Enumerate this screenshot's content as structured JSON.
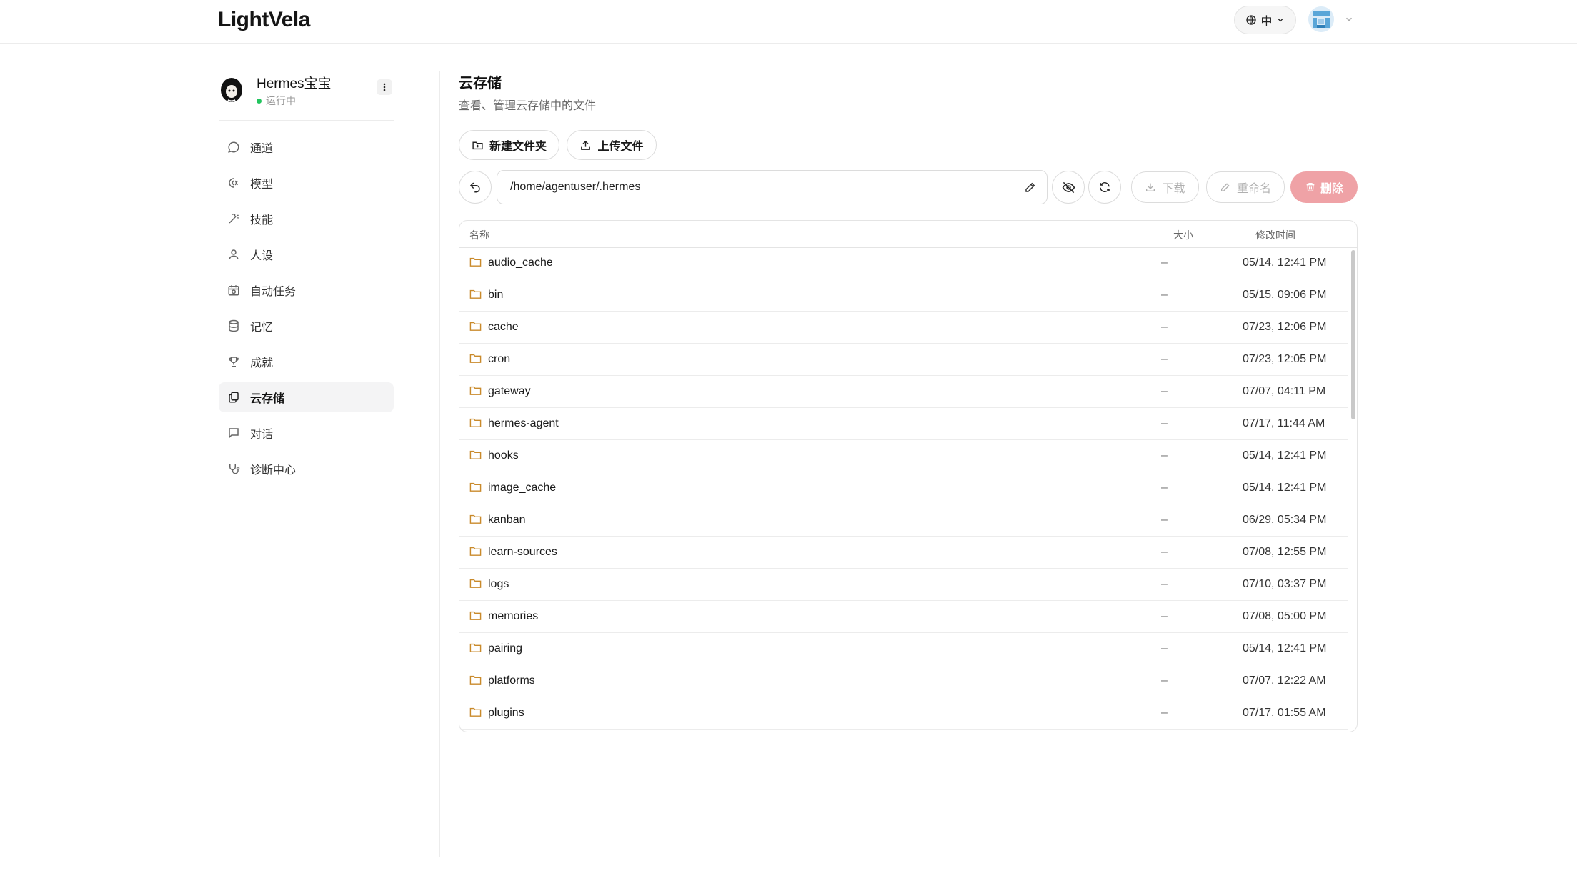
{
  "app": {
    "logo": "LightVela"
  },
  "header": {
    "lang_label": "中"
  },
  "agent": {
    "name": "Hermes宝宝",
    "status": "运行中"
  },
  "nav": [
    {
      "label": "通道",
      "icon": "chat-bubble-icon",
      "active": false
    },
    {
      "label": "模型",
      "icon": "model-icon",
      "active": false
    },
    {
      "label": "技能",
      "icon": "magic-wand-icon",
      "active": false
    },
    {
      "label": "人设",
      "icon": "user-icon",
      "active": false
    },
    {
      "label": "自动任务",
      "icon": "calendar-clock-icon",
      "active": false
    },
    {
      "label": "记忆",
      "icon": "database-icon",
      "active": false
    },
    {
      "label": "成就",
      "icon": "trophy-icon",
      "active": false
    },
    {
      "label": "云存储",
      "icon": "cloud-storage-icon",
      "active": true
    },
    {
      "label": "对话",
      "icon": "message-square-icon",
      "active": false
    },
    {
      "label": "诊断中心",
      "icon": "stethoscope-icon",
      "active": false
    }
  ],
  "page": {
    "title": "云存储",
    "subtitle": "查看、管理云存储中的文件",
    "new_folder_label": "新建文件夹",
    "upload_label": "上传文件",
    "path_value": "/home/agentuser/.hermes",
    "download_label": "下载",
    "rename_label": "重命名",
    "delete_label": "删除"
  },
  "table": {
    "columns": {
      "name": "名称",
      "size": "大小",
      "modified": "修改时间"
    },
    "rows": [
      {
        "name": "audio_cache",
        "size": "–",
        "modified": "05/14, 12:41 PM"
      },
      {
        "name": "bin",
        "size": "–",
        "modified": "05/15, 09:06 PM"
      },
      {
        "name": "cache",
        "size": "–",
        "modified": "07/23, 12:06 PM"
      },
      {
        "name": "cron",
        "size": "–",
        "modified": "07/23, 12:05 PM"
      },
      {
        "name": "gateway",
        "size": "–",
        "modified": "07/07, 04:11 PM"
      },
      {
        "name": "hermes-agent",
        "size": "–",
        "modified": "07/17, 11:44 AM"
      },
      {
        "name": "hooks",
        "size": "–",
        "modified": "05/14, 12:41 PM"
      },
      {
        "name": "image_cache",
        "size": "–",
        "modified": "05/14, 12:41 PM"
      },
      {
        "name": "kanban",
        "size": "–",
        "modified": "06/29, 05:34 PM"
      },
      {
        "name": "learn-sources",
        "size": "–",
        "modified": "07/08, 12:55 PM"
      },
      {
        "name": "logs",
        "size": "–",
        "modified": "07/10, 03:37 PM"
      },
      {
        "name": "memories",
        "size": "–",
        "modified": "07/08, 05:00 PM"
      },
      {
        "name": "pairing",
        "size": "–",
        "modified": "05/14, 12:41 PM"
      },
      {
        "name": "platforms",
        "size": "–",
        "modified": "07/07, 12:22 AM"
      },
      {
        "name": "plugins",
        "size": "–",
        "modified": "07/17, 01:55 AM"
      }
    ]
  },
  "colors": {
    "accent_delete": "#efa2a6",
    "status_running": "#22c55e",
    "folder_icon": "#c98a2b"
  }
}
